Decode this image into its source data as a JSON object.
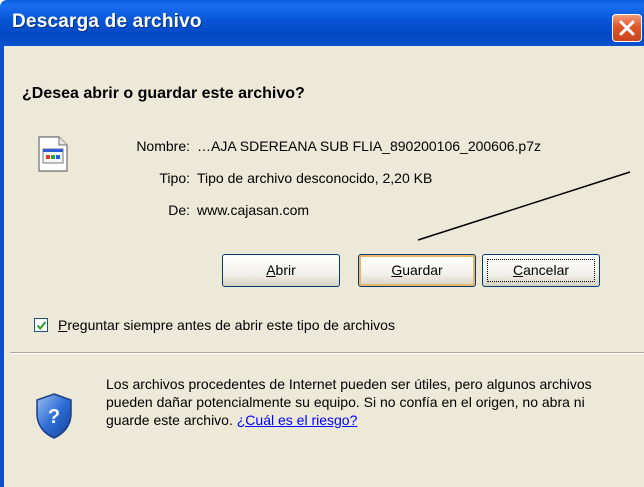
{
  "window": {
    "title": "Descarga de archivo"
  },
  "dialog": {
    "heading": "¿Desea abrir o guardar este archivo?",
    "fields": [
      {
        "label": "Nombre:",
        "value": "…AJA SDEREANA SUB FLIA_890200106_200606.p7z"
      },
      {
        "label": "Tipo:",
        "value": "Tipo de archivo desconocido, 2,20 KB"
      },
      {
        "label": "De:",
        "value": "www.cajasan.com"
      }
    ],
    "buttons": {
      "open": "Abrir",
      "save": "Guardar",
      "cancel": "Cancelar"
    },
    "checkbox": {
      "label": "Preguntar siempre antes de abrir este tipo de archivos",
      "checked": true
    },
    "warning": {
      "text": "Los archivos procedentes de Internet pueden ser útiles, pero algunos archivos pueden dañar potencialmente su equipo. Si no confía en el origen, no abra ni guarde este archivo. ",
      "link": "¿Cuál es el riesgo?"
    }
  },
  "colors": {
    "titlebar": "#0755d6",
    "close": "#e0572a",
    "client": "#ece9d8",
    "link": "#0000ff"
  },
  "icons": [
    "unknown-file-icon",
    "close-icon",
    "checkmark-icon",
    "security-shield-icon"
  ]
}
